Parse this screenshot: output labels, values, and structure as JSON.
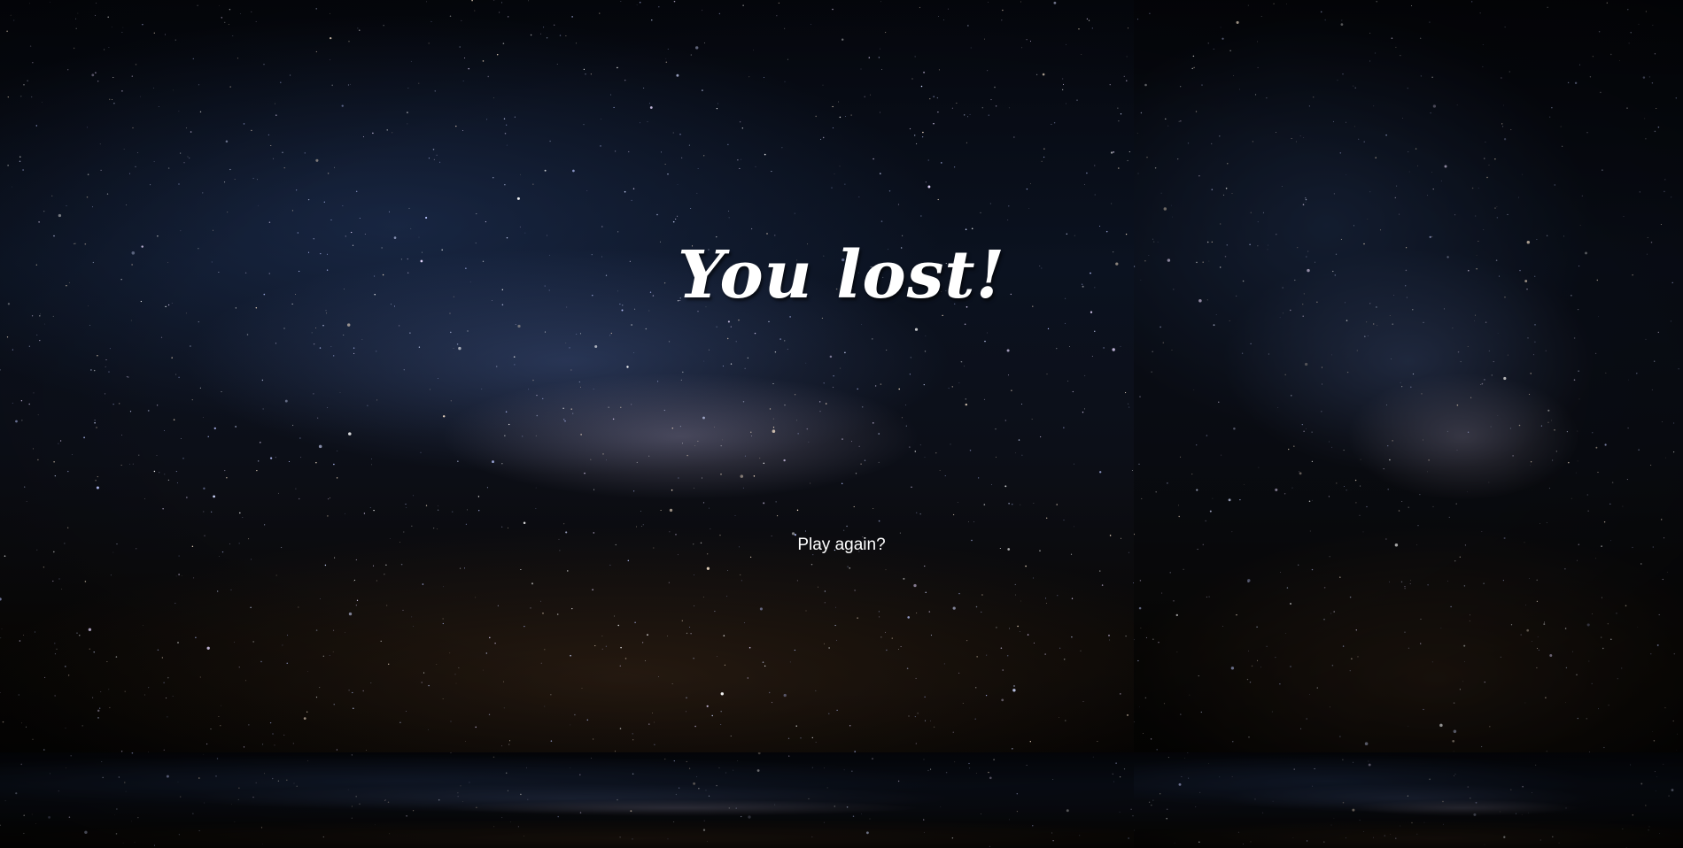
{
  "screen": {
    "title": "You lost!",
    "play_again_label": "Play again?"
  },
  "colors": {
    "text": "#ffffff",
    "background": "#020306"
  }
}
